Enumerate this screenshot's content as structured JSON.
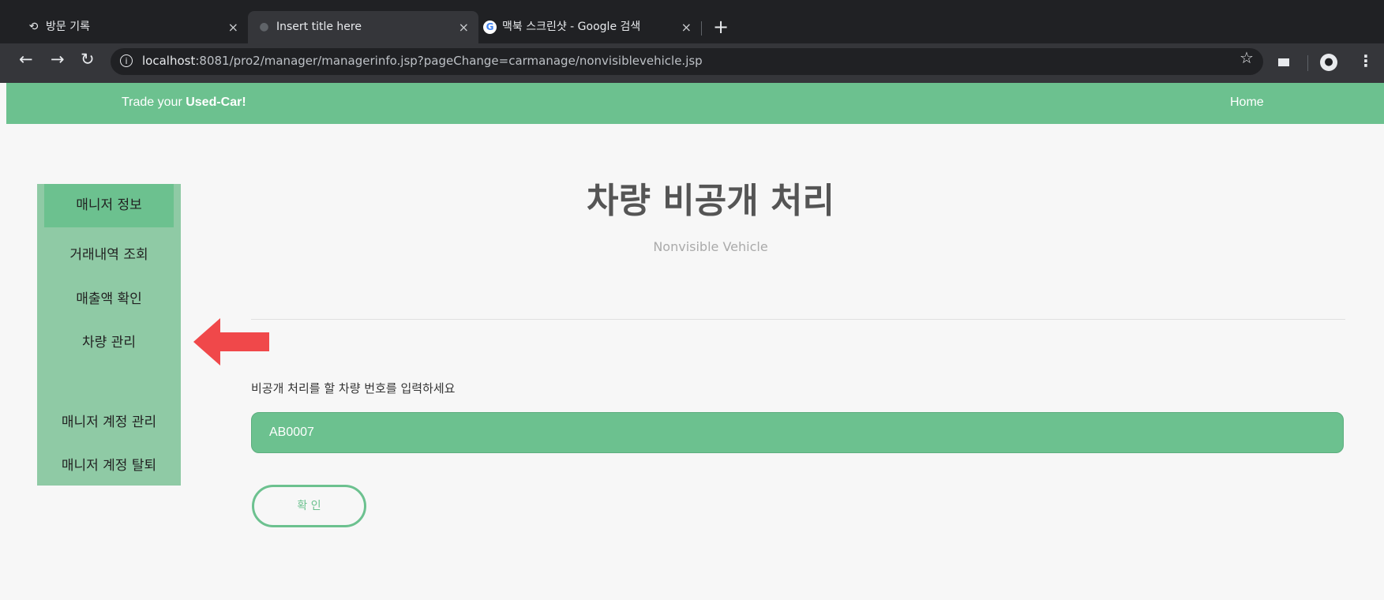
{
  "browser": {
    "tabs": [
      {
        "title": "방문 기록",
        "icon": "history-icon"
      },
      {
        "title": "Insert title here",
        "icon": "globe-icon"
      },
      {
        "title": "맥북 스크린샷 - Google 검색",
        "icon": "google-icon"
      }
    ],
    "close_glyph": "×",
    "new_tab_glyph": "+",
    "url_host": "localhost",
    "url_rest": ":8081/pro2/manager/managerinfo.jsp?pageChange=carmanage/nonvisiblevehicle.jsp"
  },
  "header": {
    "brand_prefix": "Trade your ",
    "brand_bold": "Used-Car!",
    "home": "Home"
  },
  "sidebar": {
    "items": [
      {
        "label": "매니저 정보"
      },
      {
        "label": "거래내역 조회"
      },
      {
        "label": "매출액 확인"
      },
      {
        "label": "차량 관리"
      },
      {
        "label": "매니저 계정 관리"
      },
      {
        "label": "매니저 계정 탈퇴"
      }
    ]
  },
  "main": {
    "title": "차량 비공개 처리",
    "subtitle": "Nonvisible Vehicle",
    "prompt": "비공개 처리를 할 차량 번호를 입력하세요",
    "input_value": "AB0007",
    "confirm": "확 인"
  },
  "colors": {
    "accent": "#6cc18f",
    "sidebar": "#8fcaa5",
    "arrow": "#f0484a"
  }
}
